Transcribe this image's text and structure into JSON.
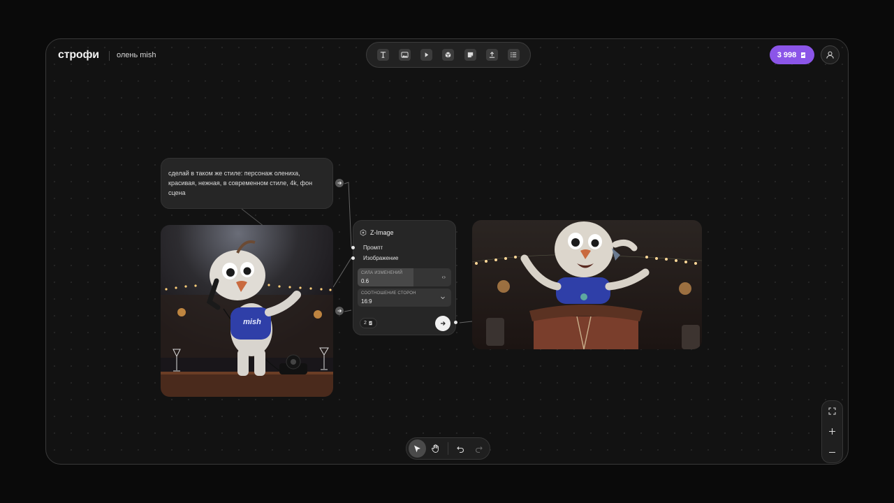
{
  "header": {
    "brand": "строфи",
    "project_name": "олень mish",
    "credits": "3 998"
  },
  "toolbar": {
    "tools": [
      "text-tool-icon",
      "image-tool-icon",
      "video-tool-icon",
      "3d-tool-icon",
      "note-tool-icon",
      "upload-tool-icon",
      "list-tool-icon"
    ]
  },
  "prompt_node": {
    "text": "сделай в таком же стиле: персонаж олениха, красивая, нежная, в современном стиле, 4k, фон сцена"
  },
  "model_node": {
    "title": "Z-Image",
    "inputs": [
      "Промпт",
      "Изображение"
    ],
    "strength": {
      "label": "СИЛА ИЗМЕНЕНИЙ",
      "value": "0.6",
      "fill": 0.6
    },
    "aspect": {
      "label": "СООТНОШЕНИЕ СТОРОН",
      "value": "16:9"
    },
    "cost": "2"
  },
  "source_image": {
    "shirt_text": "mish"
  },
  "colors": {
    "accent": "#8b55e8",
    "shirt": "#2f3fa8"
  }
}
